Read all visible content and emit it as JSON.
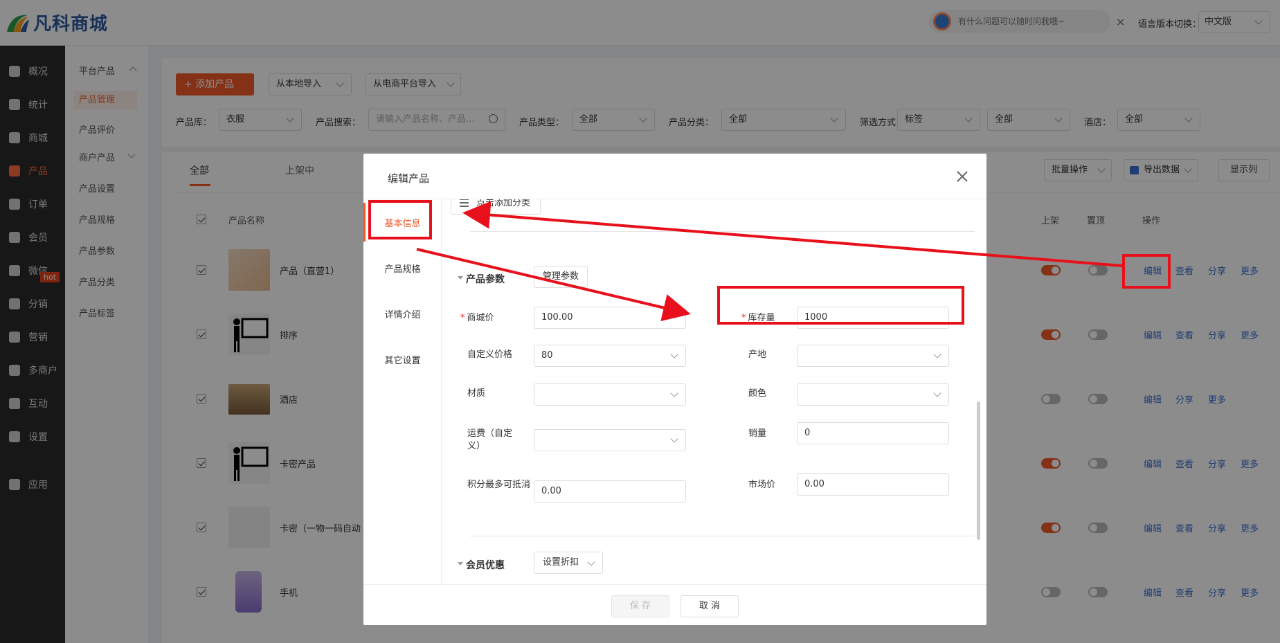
{
  "header": {
    "logo_text": "凡科商城",
    "search_placeholder": "有什么问题可以随时问我哦~",
    "close_icon": "×",
    "lang_label": "语言版本切换：",
    "lang_value": "中文版"
  },
  "nav": {
    "items": [
      {
        "label": "概况",
        "icon": "layers-icon"
      },
      {
        "label": "统计",
        "icon": "chart-icon"
      },
      {
        "label": "商城",
        "icon": "store-icon"
      },
      {
        "label": "产品",
        "icon": "grid-icon"
      },
      {
        "label": "订单",
        "icon": "order-icon"
      },
      {
        "label": "会员",
        "icon": "crown-icon"
      },
      {
        "label": "微信",
        "icon": "wechat-icon"
      },
      {
        "label": "分销",
        "icon": "users-icon"
      },
      {
        "label": "营销",
        "icon": "flag-icon"
      },
      {
        "label": "多商户",
        "icon": "shop-icon"
      },
      {
        "label": "互动",
        "icon": "interact-icon"
      },
      {
        "label": "设置",
        "icon": "gear-icon"
      },
      {
        "label": "应用",
        "icon": "apps-icon"
      }
    ],
    "hot_badge": "hot",
    "accent": "#f05a28"
  },
  "subnav": {
    "group1": "平台产品",
    "items1": [
      "产品管理",
      "产品评价"
    ],
    "group2": "商户产品",
    "items2": [
      "产品设置",
      "产品规格",
      "产品参数",
      "产品分类",
      "产品标签"
    ]
  },
  "filter": {
    "add_btn": "+ 添加产品",
    "import_local": "从本地导入",
    "import_platform": "从电商平台导入",
    "lib_label": "产品库：",
    "lib_value": "衣服",
    "search_label": "产品搜索：",
    "search_placeholder": "请输入产品名称、产品...",
    "type_label": "产品类型：",
    "type_value": "全部",
    "cat_label": "产品分类：",
    "cat_value": "全部",
    "filter_label": "筛选方式：",
    "filter_value": "标签",
    "filter_value2": "全部",
    "hotel_label": "酒店：",
    "hotel_value": "全部"
  },
  "table": {
    "tabs": [
      "全部",
      "上架中"
    ],
    "batch_btn": "批量操作",
    "export_btn": "导出数据",
    "columns_btn": "显示列",
    "col_name": "产品名称",
    "col_onsale": "上架",
    "col_top": "置顶",
    "col_ops": "操作",
    "rows": [
      {
        "name": "产品（直营1）",
        "onsale": true,
        "actions": [
          "编辑",
          "查看",
          "分享",
          "更多"
        ]
      },
      {
        "name": "排序",
        "onsale": true,
        "actions": [
          "编辑",
          "查看",
          "分享",
          "更多"
        ]
      },
      {
        "name": "酒店",
        "onsale": false,
        "actions": [
          "编辑",
          "分享",
          "更多"
        ]
      },
      {
        "name": "卡密产品",
        "onsale": true,
        "actions": [
          "编辑",
          "查看",
          "分享",
          "更多"
        ]
      },
      {
        "name": "卡密（一物一码自动",
        "onsale": true,
        "actions": [
          "编辑",
          "查看",
          "分享",
          "更多"
        ]
      },
      {
        "name": "手机",
        "onsale": false,
        "actions": [
          "编辑",
          "查看",
          "分享",
          "更多"
        ]
      }
    ]
  },
  "modal": {
    "title": "编辑产品",
    "tabs": [
      "基本信息",
      "产品规格",
      "详情介绍",
      "其它设置"
    ],
    "add_category_btn": "点击添加分类",
    "params_section": "产品参数",
    "manage_params_btn": "管理参数",
    "fields": {
      "mall_price_label": "商城价",
      "mall_price": "100.00",
      "stock_label": "库存量",
      "stock": "1000",
      "custom_price_label": "自定义价格",
      "custom_price": "80",
      "origin_label": "产地",
      "origin": "",
      "material_label": "材质",
      "material": "",
      "color_label": "颜色",
      "color": "",
      "freight_label": "运费（自定义）",
      "freight": "",
      "sales_label": "销量",
      "sales": "0",
      "points_label": "积分最多可抵消",
      "points": "0.00",
      "market_price_label": "市场价",
      "market_price": "0.00"
    },
    "member_section": "会员优惠",
    "discount_btn": "设置折扣",
    "save_btn": "保 存",
    "cancel_btn": "取 消"
  },
  "annotation_color": "#e8101a"
}
